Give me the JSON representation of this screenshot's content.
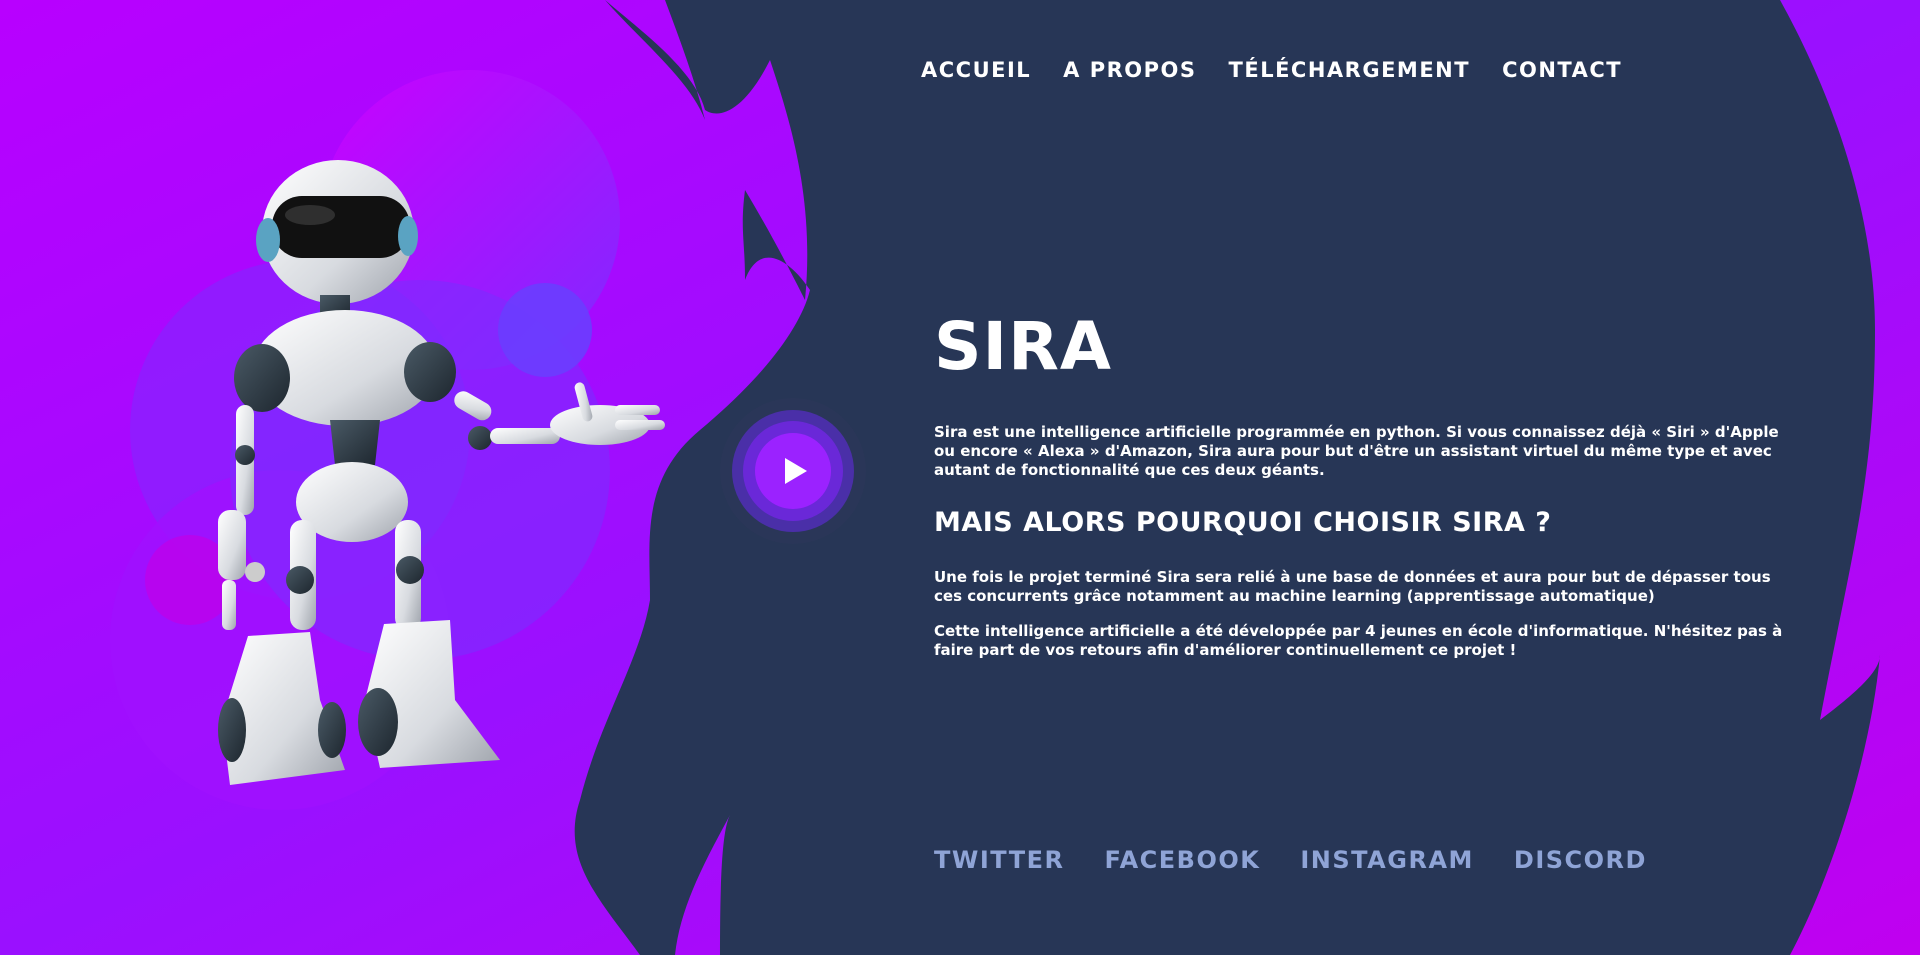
{
  "nav": {
    "items": [
      {
        "label": "ACCUEIL"
      },
      {
        "label": "A PROPOS"
      },
      {
        "label": "TÉLÉCHARGEMENT"
      },
      {
        "label": "CONTACT"
      }
    ]
  },
  "hero": {
    "title": "SIRA",
    "intro": "Sira est une intelligence artificielle programmée en python. Si vous connaissez déjà « Siri » d'Apple ou encore « Alexa » d'Amazon, Sira aura pour but d'être un assistant virtuel du même type et avec autant de fonctionnalité que ces deux géants.",
    "subtitle": "MAIS ALORS POURQUOI CHOISIR SIRA ?",
    "para1": "Une fois le projet terminé Sira sera relié à une base de données et aura pour but de dépasser tous ces concurrents grâce notamment au machine learning (apprentissage automatique)",
    "para2": "Cette intelligence artificielle a été développée par 4 jeunes en école d'informatique. N'hésitez pas à faire part de vos retours afin d'améliorer continuellement ce projet !"
  },
  "social": {
    "items": [
      {
        "label": "TWITTER"
      },
      {
        "label": "FACEBOOK"
      },
      {
        "label": "INSTAGRAM"
      },
      {
        "label": "DISCORD"
      }
    ]
  },
  "play_button": {
    "icon": "play-icon"
  },
  "colors": {
    "background_purple": "#b300ff",
    "panel_navy": "#273656",
    "social_text": "#8fa4d6",
    "text": "#ffffff"
  }
}
